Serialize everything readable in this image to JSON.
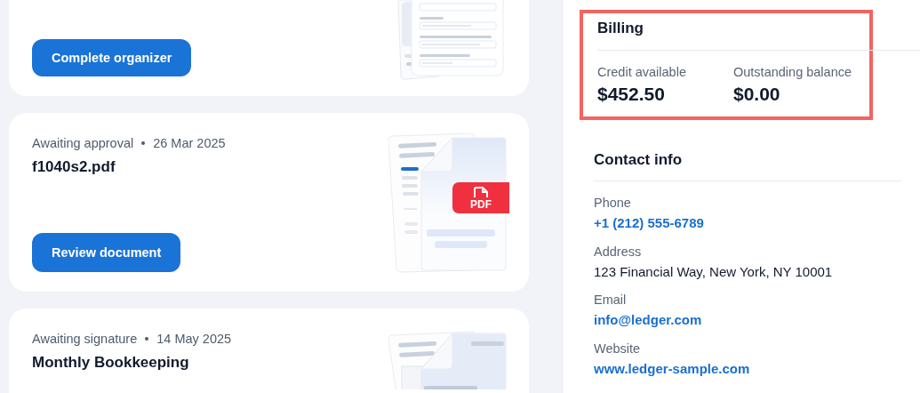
{
  "cards": [
    {
      "kind": "form",
      "button": "Complete organizer"
    },
    {
      "kind": "pdf",
      "status": "Awaiting approval",
      "date": "26 Mar 2025",
      "title": "f1040s2.pdf",
      "button": "Review document",
      "badge": "PDF"
    },
    {
      "kind": "doc",
      "status": "Awaiting signature",
      "date": "14 May 2025",
      "title": "Monthly Bookkeeping"
    }
  ],
  "billing": {
    "title": "Billing",
    "highlighted": true,
    "items": [
      {
        "label": "Credit available",
        "value": "$452.50"
      },
      {
        "label": "Outstanding balance",
        "value": "$0.00"
      }
    ]
  },
  "contact": {
    "title": "Contact info",
    "fields": [
      {
        "label": "Phone",
        "value": "+1 (212) 555-6789",
        "kind": "link"
      },
      {
        "label": "Address",
        "value": "123 Financial Way, New York, NY 10001",
        "kind": "text"
      },
      {
        "label": "Email",
        "value": "info@ledger.com",
        "kind": "link"
      },
      {
        "label": "Website",
        "value": "www.ledger-sample.com",
        "kind": "link"
      }
    ]
  }
}
